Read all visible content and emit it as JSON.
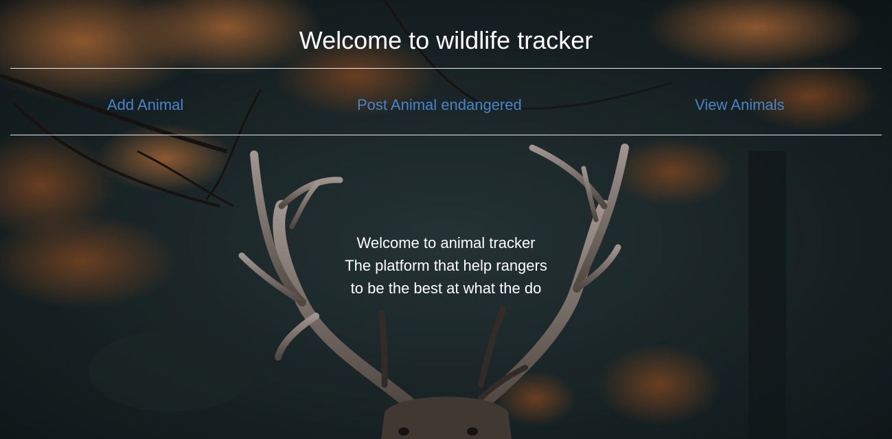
{
  "header": {
    "title": "Welcome to wildlife tracker"
  },
  "nav": {
    "items": [
      {
        "label": "Add Animal",
        "icon": "none"
      },
      {
        "label": "Post Animal endangered",
        "icon": "none"
      },
      {
        "label": "View Animals",
        "icon": "none"
      }
    ]
  },
  "hero": {
    "lines": [
      "Welcome to animal tracker",
      "The platform that help rangers",
      "to be the best at what the do"
    ]
  },
  "colors": {
    "link": "#4a84c6",
    "text": "#ffffff",
    "rule": "#e8e8e8",
    "background_dark": "#1a2226",
    "foliage_orange": "#a8602c"
  },
  "background": {
    "subject": "deer-antlers-in-forest-photo"
  }
}
